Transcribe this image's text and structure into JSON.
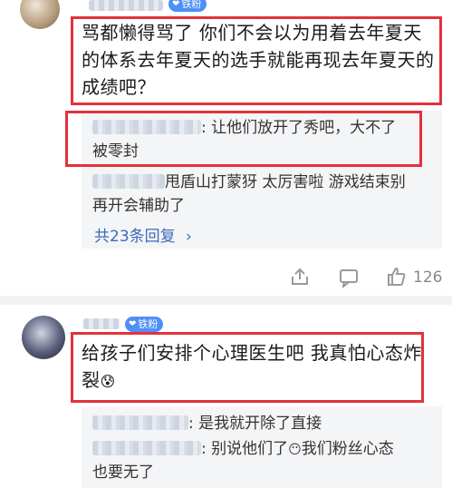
{
  "comment1": {
    "badge": "铁粉",
    "text_lines": [
      "骂都懒得骂了 你们不会以为用着去年夏天",
      "的体系去年夏天的选手就能再现去年夏天的",
      "成绩吧？"
    ],
    "replies": [
      {
        "lines": [
          ": 让他们放开了秀吧，大不了",
          "被零封"
        ]
      },
      {
        "lines": [
          "甩盾山打蒙犽 太厉害啦 游戏结束别",
          "再开会辅助了"
        ]
      }
    ],
    "more_replies": "共23条回复",
    "like_count": "126"
  },
  "comment2": {
    "badge": "铁粉",
    "text_lines": [
      "给孩子们安排个心理医生吧 我真怕心态炸",
      "裂"
    ],
    "replies": [
      {
        "lines": [
          ": 是我就开除了直接"
        ]
      },
      {
        "lines": [
          ": 别说他们了",
          "我们粉丝心态",
          "也要无了"
        ]
      }
    ]
  },
  "colors": {
    "highlight": "#e3323b",
    "link": "#3b6bb8",
    "badge": "#4f8ff7"
  }
}
